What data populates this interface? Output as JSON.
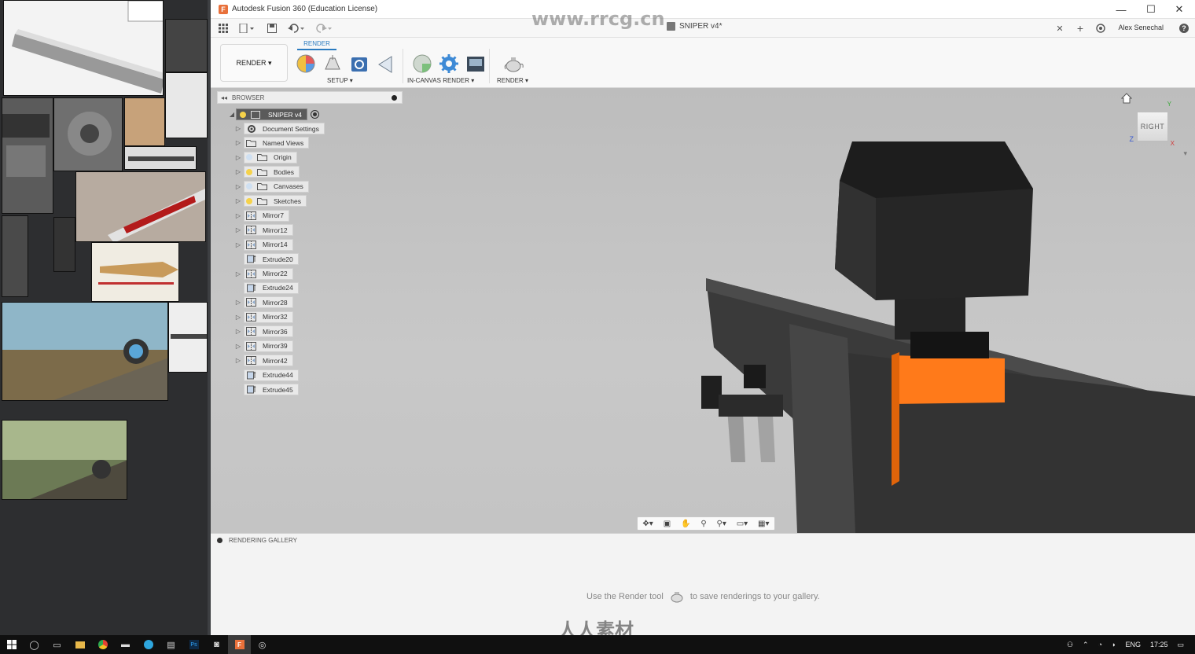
{
  "window": {
    "title": "Autodesk Fusion 360 (Education License)",
    "app_icon_letter": "F",
    "controls": [
      "—",
      "☐",
      "✕"
    ]
  },
  "quick_access": {
    "document_tab": "SNIPER v4*",
    "user": "Alex Senechal",
    "help": "?"
  },
  "ribbon": {
    "workspace": "RENDER ▾",
    "active_tab": "RENDER",
    "groups": [
      {
        "label": "SETUP ▾"
      },
      {
        "label": "IN-CANVAS RENDER ▾"
      },
      {
        "label": "RENDER ▾"
      }
    ]
  },
  "browser": {
    "title": "BROWSER",
    "root": "SNIPER v4",
    "items": [
      {
        "label": "Document Settings",
        "icon": "gear-icon",
        "expandable": true
      },
      {
        "label": "Named Views",
        "icon": "folder-icon",
        "expandable": true
      },
      {
        "label": "Origin",
        "icon": "folder-icon",
        "expandable": true,
        "bulb": true
      },
      {
        "label": "Bodies",
        "icon": "folder-icon",
        "expandable": true,
        "bulb": true
      },
      {
        "label": "Canvases",
        "icon": "folder-icon",
        "expandable": true,
        "bulb": true
      },
      {
        "label": "Sketches",
        "icon": "folder-icon",
        "expandable": true,
        "bulb": true
      },
      {
        "label": "Mirror7",
        "icon": "mirror-icon",
        "expandable": true
      },
      {
        "label": "Mirror12",
        "icon": "mirror-icon",
        "expandable": true
      },
      {
        "label": "Mirror14",
        "icon": "mirror-icon",
        "expandable": true
      },
      {
        "label": "Extrude20",
        "icon": "extrude-icon",
        "expandable": false
      },
      {
        "label": "Mirror22",
        "icon": "mirror-icon",
        "expandable": true
      },
      {
        "label": "Extrude24",
        "icon": "extrude-icon",
        "expandable": false
      },
      {
        "label": "Mirror28",
        "icon": "mirror-icon",
        "expandable": true
      },
      {
        "label": "Mirror32",
        "icon": "mirror-icon",
        "expandable": true
      },
      {
        "label": "Mirror36",
        "icon": "mirror-icon",
        "expandable": true
      },
      {
        "label": "Mirror39",
        "icon": "mirror-icon",
        "expandable": true
      },
      {
        "label": "Mirror42",
        "icon": "mirror-icon",
        "expandable": true
      },
      {
        "label": "Extrude44",
        "icon": "extrude-icon",
        "expandable": false
      },
      {
        "label": "Extrude45",
        "icon": "extrude-icon",
        "expandable": false
      }
    ]
  },
  "viewcube": {
    "face": "RIGHT",
    "axis_y": "Y",
    "axis_z": "Z",
    "axis_x": "X"
  },
  "gallery": {
    "title": "RENDERING GALLERY",
    "message_before": "Use the Render tool",
    "message_after": "to save renderings to your gallery."
  },
  "taskbar": {
    "language": "ENG",
    "time": "17:25"
  },
  "watermark": {
    "url": "www.rrcg.cn",
    "brand": "人人素材"
  },
  "colors": {
    "accent": "#2a7bc0",
    "model_orange": "#ff7a1a",
    "model_dark": "#2f2f2f"
  }
}
